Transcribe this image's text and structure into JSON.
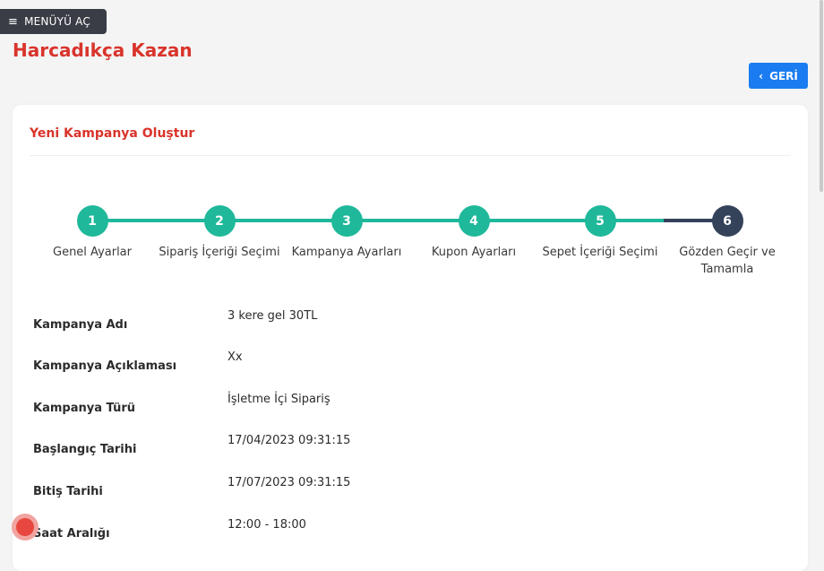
{
  "menu": {
    "label": "MENÜYÜ AÇ",
    "icon": "hamburger-icon"
  },
  "page": {
    "title": "Harcadıkça Kazan"
  },
  "back_button": {
    "label": "GERİ",
    "icon": "chevron-left-icon"
  },
  "card": {
    "title": "Yeni Kampanya Oluştur"
  },
  "colors": {
    "accent_red": "#d9342b",
    "step_done": "#1fb89a",
    "step_current": "#34425a",
    "button_blue": "#1a7cf0"
  },
  "steps": [
    {
      "number": "1",
      "label": "Genel Ayarlar",
      "status": "completed"
    },
    {
      "number": "2",
      "label": "Sipariş İçeriği Seçimi",
      "status": "completed"
    },
    {
      "number": "3",
      "label": "Kampanya Ayarları",
      "status": "completed"
    },
    {
      "number": "4",
      "label": "Kupon Ayarları",
      "status": "completed"
    },
    {
      "number": "5",
      "label": "Sepet İçeriği Seçimi",
      "status": "completed"
    },
    {
      "number": "6",
      "label": "Gözden Geçir ve Tamamla",
      "status": "current"
    }
  ],
  "details": [
    {
      "label": "Kampanya Adı",
      "value": "3 kere gel 30TL"
    },
    {
      "label": "Kampanya Açıklaması",
      "value": "Xx"
    },
    {
      "label": "Kampanya Türü",
      "value": "İşletme İçi Sipariş"
    },
    {
      "label": "Başlangıç Tarihi",
      "value": "17/04/2023 09:31:15"
    },
    {
      "label": "Bitiş Tarihi",
      "value": "17/07/2023 09:31:15"
    },
    {
      "label": "Saat Aralığı",
      "value": "12:00 - 18:00"
    }
  ]
}
